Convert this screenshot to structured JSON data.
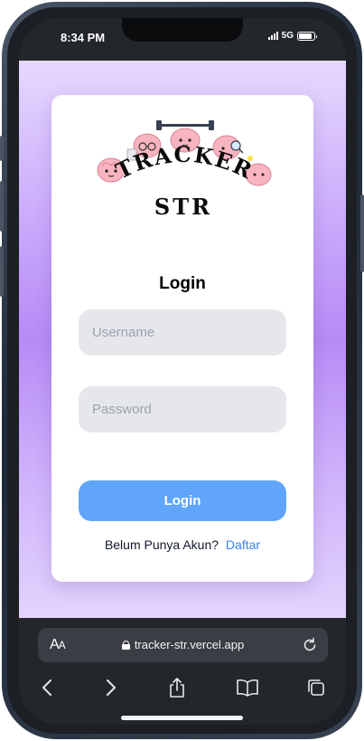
{
  "status_bar": {
    "time": "8:34 PM",
    "network": "5G",
    "battery_level": 0.9
  },
  "app": {
    "logo_text_line1": "TRACKER",
    "logo_text_line2": "STR",
    "title": "Login",
    "username_placeholder": "Username",
    "password_placeholder": "Password",
    "login_button_label": "Login",
    "register_prompt": "Belum Punya Akun?",
    "register_link": "Daftar"
  },
  "browser": {
    "text_size_label": "AA",
    "url": "tracker-str.vercel.app",
    "icons": [
      "back-icon",
      "forward-icon",
      "share-icon",
      "bookmarks-icon",
      "tabs-icon"
    ]
  },
  "colors": {
    "accent_button": "#60a5fa",
    "link": "#3b82f6",
    "background_purple": "#b78bf6"
  }
}
